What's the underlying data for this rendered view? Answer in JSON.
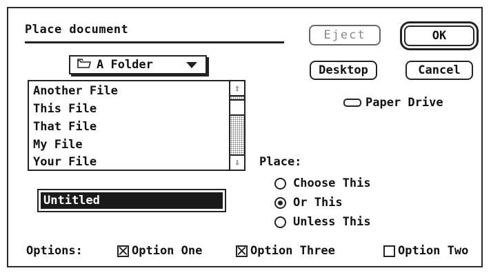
{
  "dialog": {
    "title": "Place document",
    "buttons": {
      "eject": "Eject",
      "ok": "OK",
      "desktop": "Desktop",
      "cancel": "Cancel"
    },
    "folder_popup": {
      "label": "A Folder",
      "icon": "folder-icon"
    },
    "file_list": {
      "items": [
        "Another File",
        "This File",
        "That File",
        "My File",
        "Your File"
      ]
    },
    "drive": {
      "label": "Paper Drive",
      "icon": "disk-icon"
    },
    "filename": {
      "value": "Untitled"
    },
    "place": {
      "label": "Place:",
      "options": [
        {
          "label": "Choose This",
          "selected": false
        },
        {
          "label": "Or This",
          "selected": true
        },
        {
          "label": "Unless This",
          "selected": false
        }
      ]
    },
    "options": {
      "label": "Options:",
      "checkboxes": [
        {
          "label": "Option One",
          "checked": true
        },
        {
          "label": "Option Three",
          "checked": true
        },
        {
          "label": "Option Two",
          "checked": false
        }
      ]
    }
  }
}
